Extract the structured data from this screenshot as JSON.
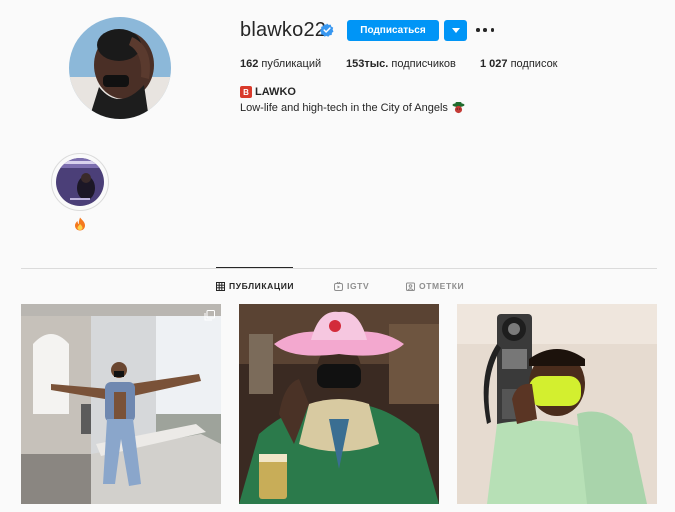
{
  "profile": {
    "username": "blawko22",
    "verified": true,
    "follow_label": "Подписаться",
    "stats": {
      "posts_count": "162",
      "posts_label": "публикаций",
      "followers_count": "153тыс.",
      "followers_label": "подписчиков",
      "following_count": "1 027",
      "following_label": "подписок"
    },
    "full_name": "LAWKO",
    "full_name_emoji": "B",
    "bio": "Low-life and high-tech in the City of Angels"
  },
  "highlights": [
    {
      "label_icon": "fire-emoji-icon"
    }
  ],
  "tabs": [
    {
      "label": "ПУБЛИКАЦИИ",
      "icon": "grid-icon",
      "active": true
    },
    {
      "label": "IGTV",
      "icon": "igtv-icon",
      "active": false
    },
    {
      "label": "ОТМЕТКИ",
      "icon": "tagged-icon",
      "active": false
    }
  ],
  "posts": [
    {
      "icon": "multiple-photos-icon"
    },
    {
      "icon": ""
    },
    {
      "icon": ""
    }
  ],
  "colors": {
    "accent": "#0095f6",
    "background": "#fafafa",
    "text": "#262626",
    "muted": "#8e8e8e",
    "border": "#dbdbdb"
  }
}
